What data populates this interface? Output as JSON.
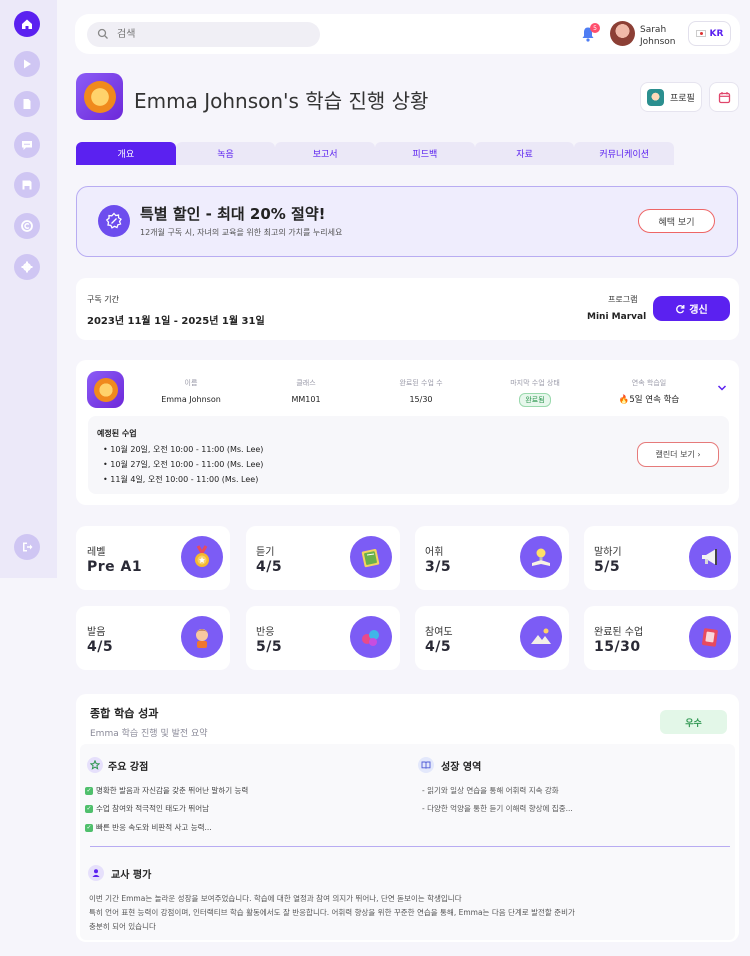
{
  "sidebar": {
    "items": [
      {
        "name": "home-icon",
        "active": true
      },
      {
        "name": "play-icon"
      },
      {
        "name": "document-icon"
      },
      {
        "name": "chat-icon"
      },
      {
        "name": "save-icon"
      },
      {
        "name": "copyright-icon"
      },
      {
        "name": "settings-icon"
      }
    ],
    "logout_icon": "logout-icon"
  },
  "topbar": {
    "search_placeholder": "검색",
    "notification_count": "5",
    "user_first": "Sarah",
    "user_last": "Johnson",
    "lang": "KR"
  },
  "header": {
    "title": "Emma Johnson's 학습 진행 상황",
    "profile_label": "프로필"
  },
  "tabs": [
    "개요",
    "녹음",
    "보고서",
    "피드백",
    "자료",
    "커뮤니케이션"
  ],
  "promo": {
    "title": "특별 할인 - 최대 20% 절약!",
    "subtitle": "12개월 구독 시, 자녀의 교육을 위한 최고의 가치를 누리세요",
    "button": "혜택 보기"
  },
  "subscription": {
    "period_label": "구독 기간",
    "period_value": "2023년 11월 1일 - 2025년 1월 31일",
    "program_label": "프로그램",
    "program_value": "Mini Marval",
    "renew_button": "갱신"
  },
  "student": {
    "headers": [
      "이름",
      "클래스",
      "완료된 수업 수",
      "마지막 수업 상태",
      "연속 학습일"
    ],
    "name": "Emma Johnson",
    "class": "MM101",
    "completed": "15/30",
    "status": "완료됨",
    "streak": "5일 연속 학습",
    "schedule_title": "예정된 수업",
    "schedule": [
      "10월 20일, 오전 10:00 - 11:00 (Ms. Lee)",
      "10월 27일, 오전 10:00 - 11:00 (Ms. Lee)",
      "11월 4일, 오전 10:00 - 11:00 (Ms. Lee)"
    ],
    "calendar_button": "캘린더 보기 ›"
  },
  "stats": [
    {
      "label": "레벨",
      "value": "Pre A1",
      "icon": "medal-icon"
    },
    {
      "label": "듣기",
      "value": "4/5",
      "icon": "book-icon"
    },
    {
      "label": "어휘",
      "value": "3/5",
      "icon": "lightbulb-icon"
    },
    {
      "label": "말하기",
      "value": "5/5",
      "icon": "megaphone-icon"
    },
    {
      "label": "발음",
      "value": "4/5",
      "icon": "child-icon"
    },
    {
      "label": "반응",
      "value": "5/5",
      "icon": "paint-icon"
    },
    {
      "label": "참여도",
      "value": "4/5",
      "icon": "landscape-icon"
    },
    {
      "label": "완료된 수업",
      "value": "15/30",
      "icon": "notebook-icon"
    }
  ],
  "summary": {
    "title": "종합 학습 성과",
    "subtitle": "Emma 학습 진행 및 발전 요약",
    "grade": "우수",
    "strengths_title": "주요 강점",
    "strengths": [
      "명확한 발음과 자신감을 갖춘 뛰어난 말하기 능력",
      "수업 참여와 적극적인 태도가 뛰어남",
      "빠른 반응 속도와 비판적 사고 능력..."
    ],
    "growth_title": "성장 영역",
    "growth": [
      "- 읽기와 일상 연습을 통해 어휘력 지속 강화",
      "- 다양한 억양을 통한 듣기 이해력 향상에 집중..."
    ],
    "teacher_title": "교사 평가",
    "teacher_lines": [
      "이번 기간 Emma는 놀라운 성장을 보여주었습니다. 학습에 대한 열정과 참여 의지가 뛰어나, 단연 돋보이는 학생입니다",
      "특히 언어 표현 능력이 강점이며, 인터랙티브 학습 활동에서도 잘 반응합니다. 어휘력 향상을 위한 꾸준한 연습을 통해, Emma는 다음 단계로 발전할 준비가",
      "충분히 되어 있습니다"
    ]
  },
  "colors": {
    "accent": "#5b21f0",
    "sidebar": "#ece9f9",
    "success": "#2e9650"
  }
}
